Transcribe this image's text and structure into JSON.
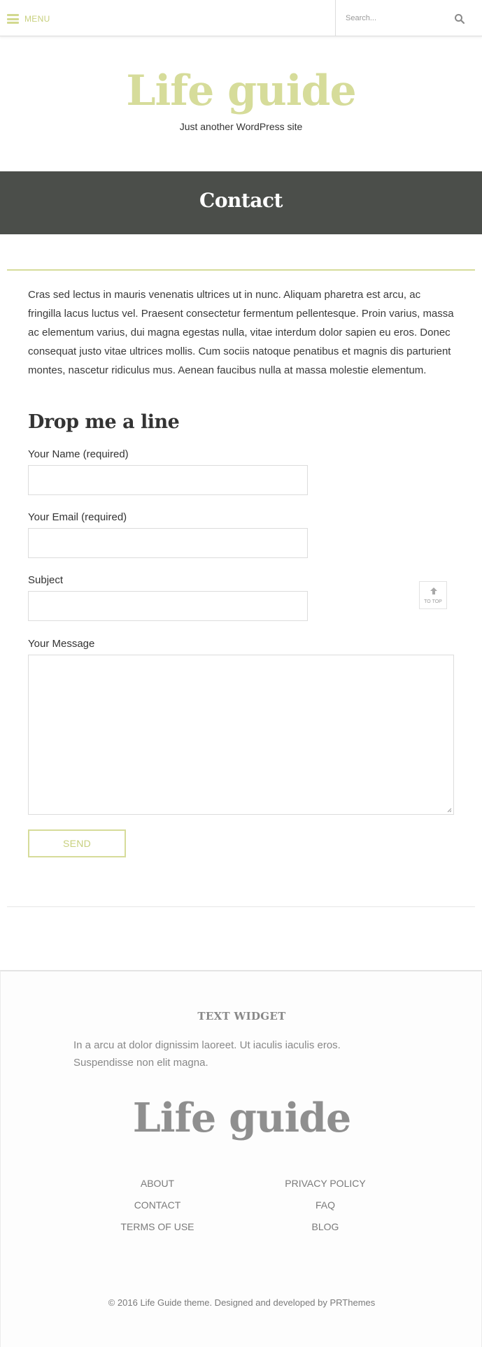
{
  "topbar": {
    "menu_label": "MENU",
    "search_placeholder": "Search..."
  },
  "header": {
    "site_title": "Life guide",
    "tagline": "Just another WordPress site"
  },
  "banner": {
    "page_title": "Contact"
  },
  "content": {
    "intro": "Cras sed lectus in mauris venenatis ultrices ut in nunc. Aliquam pharetra est arcu, ac fringilla lacus luctus vel. Praesent consectetur fermentum pellentesque. Proin varius, massa ac elementum varius, dui magna egestas nulla, vitae interdum dolor sapien eu eros. Donec consequat justo vitae ultrices mollis. Cum sociis natoque penatibus et magnis dis parturient montes, nascetur ridiculus mus. Aenean faucibus nulla at massa molestie elementum.",
    "form_title": "Drop me a line",
    "labels": {
      "name": "Your Name (required)",
      "email": "Your Email (required)",
      "subject": "Subject",
      "message": "Your Message"
    },
    "values": {
      "name": "",
      "email": "",
      "subject": "",
      "message": ""
    },
    "send_label": "SEND"
  },
  "to_top": {
    "label": "TO TOP"
  },
  "footer": {
    "widget_title": "TEXT WIDGET",
    "widget_text": "In a arcu at dolor dignissim laoreet. Ut iaculis iaculis eros. Suspendisse non elit magna.",
    "logo": "Life guide",
    "links_left": [
      "ABOUT",
      "CONTACT",
      "TERMS OF USE"
    ],
    "links_right": [
      "PRIVACY POLICY",
      "FAQ",
      "BLOG"
    ],
    "copyright": "© 2016 Life Guide theme. Designed and developed by PRThemes"
  },
  "colors": {
    "accent": "#d6dc9a",
    "banner": "#4b4e4a",
    "footer_text": "#7a7a7a"
  }
}
